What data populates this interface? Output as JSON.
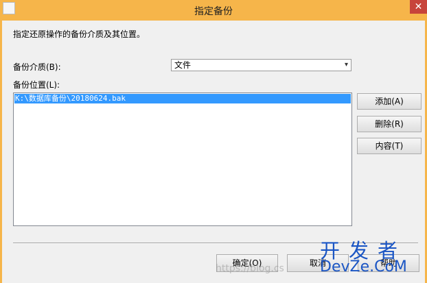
{
  "window": {
    "title": "指定备份",
    "close_glyph": "✕"
  },
  "description": "指定还原操作的备份介质及其位置。",
  "media": {
    "label": "备份介质(B):",
    "selected": "文件",
    "arrow": "▾"
  },
  "location": {
    "label": "备份位置(L):",
    "items": [
      "K:\\数据库备份\\20180624.bak"
    ]
  },
  "side_buttons": {
    "add": "添加(A)",
    "remove": "删除(R)",
    "contents": "内容(T)"
  },
  "bottom_buttons": {
    "ok": "确定(O)",
    "cancel": "取消",
    "help": "帮助"
  },
  "watermark": {
    "line1": "开发者",
    "line2": "DevZe.CoM",
    "url": "https://blog.cs"
  },
  "colors": {
    "titlebar": "#f6b54a",
    "selection": "#3399ff",
    "close": "#c7443b"
  }
}
